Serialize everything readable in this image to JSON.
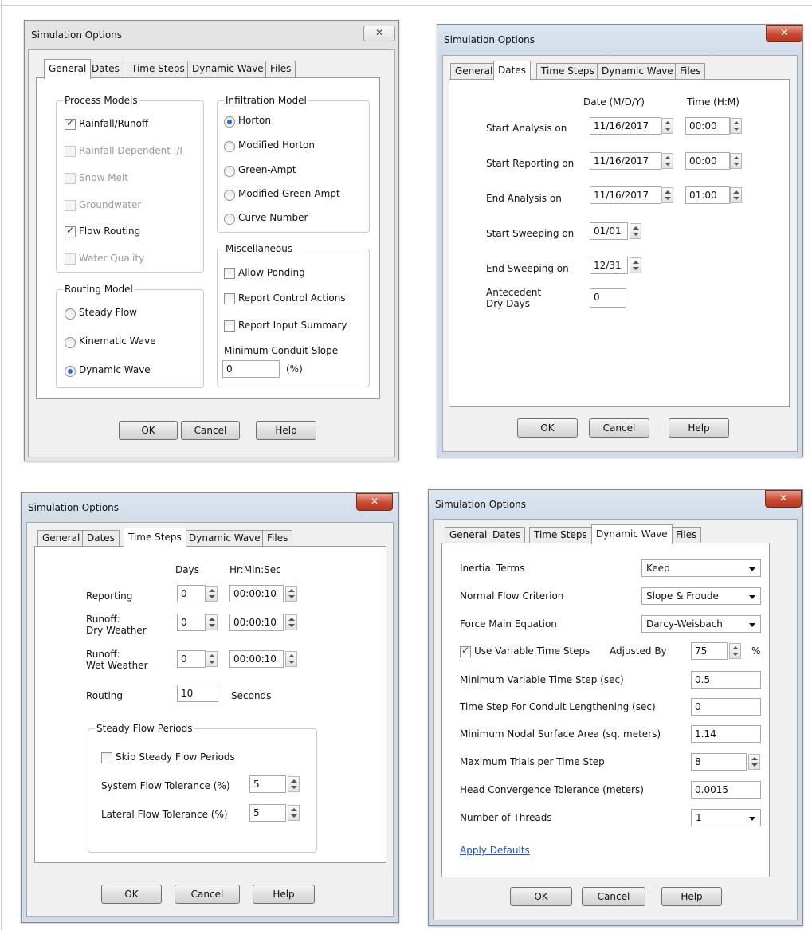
{
  "dialog_title": "Simulation Options",
  "tabs": [
    "General",
    "Dates",
    "Time Steps",
    "Dynamic Wave",
    "Files"
  ],
  "buttons": {
    "ok": "OK",
    "cancel": "Cancel",
    "help": "Help"
  },
  "close_symbol": "✕",
  "general": {
    "process_models": {
      "title": "Process Models",
      "items": [
        {
          "label": "Rainfall/Runoff",
          "checked": true,
          "enabled": true
        },
        {
          "label": "Rainfall Dependent I/I",
          "checked": false,
          "enabled": false
        },
        {
          "label": "Snow Melt",
          "checked": false,
          "enabled": false
        },
        {
          "label": "Groundwater",
          "checked": false,
          "enabled": false
        },
        {
          "label": "Flow Routing",
          "checked": true,
          "enabled": true
        },
        {
          "label": "Water Quality",
          "checked": false,
          "enabled": false
        }
      ]
    },
    "infiltration_model": {
      "title": "Infiltration Model",
      "options": [
        "Horton",
        "Modified Horton",
        "Green-Ampt",
        "Modified Green-Ampt",
        "Curve Number"
      ],
      "selected": "Horton"
    },
    "routing_model": {
      "title": "Routing Model",
      "options": [
        "Steady Flow",
        "Kinematic Wave",
        "Dynamic Wave"
      ],
      "selected": "Dynamic Wave"
    },
    "miscellaneous": {
      "title": "Miscellaneous",
      "items": [
        "Allow Ponding",
        "Report Control Actions",
        "Report Input Summary"
      ],
      "min_slope_label": "Minimum Conduit Slope",
      "min_slope_value": "0",
      "min_slope_unit": "(%)"
    }
  },
  "dates": {
    "date_header": "Date (M/D/Y)",
    "time_header": "Time (H:M)",
    "start_analysis": {
      "label": "Start Analysis on",
      "date": "11/16/2017",
      "time": "00:00"
    },
    "start_reporting": {
      "label": "Start Reporting on",
      "date": "11/16/2017",
      "time": "00:00"
    },
    "end_analysis": {
      "label": "End Analysis on",
      "date": "11/16/2017",
      "time": "01:00"
    },
    "start_sweeping": {
      "label": "Start Sweeping on",
      "value": "01/01"
    },
    "end_sweeping": {
      "label": "End Sweeping on",
      "value": "12/31"
    },
    "antecedent": {
      "label_line1": "Antecedent",
      "label_line2": "Dry Days",
      "value": "0"
    }
  },
  "time_steps": {
    "days_header": "Days",
    "hms_header": "Hr:Min:Sec",
    "reporting": {
      "label": "Reporting",
      "days": "0",
      "hms": "00:00:10"
    },
    "runoff_dry": {
      "label_line1": "Runoff:",
      "label_line2": "Dry Weather",
      "days": "0",
      "hms": "00:00:10"
    },
    "runoff_wet": {
      "label_line1": "Runoff:",
      "label_line2": "Wet Weather",
      "days": "0",
      "hms": "00:00:10"
    },
    "routing": {
      "label": "Routing",
      "value": "10",
      "unit": "Seconds"
    },
    "steady": {
      "title": "Steady Flow Periods",
      "skip_label": "Skip Steady Flow Periods",
      "system_label": "System Flow Tolerance (%)",
      "system_value": "5",
      "lateral_label": "Lateral Flow Tolerance (%)",
      "lateral_value": "5"
    }
  },
  "dynamic_wave": {
    "inertial_terms": {
      "label": "Inertial Terms",
      "value": "Keep"
    },
    "normal_flow": {
      "label": "Normal Flow Criterion",
      "value": "Slope & Froude"
    },
    "force_main": {
      "label": "Force Main Equation",
      "value": "Darcy-Weisbach"
    },
    "variable_steps": {
      "label": "Use Variable Time Steps",
      "checked": true,
      "adjusted_label": "Adjusted By",
      "adjusted_value": "75",
      "unit": "%"
    },
    "min_step": {
      "label": "Minimum Variable Time Step (sec)",
      "value": "0.5"
    },
    "lengthening": {
      "label": "Time Step For Conduit Lengthening (sec)",
      "value": "0"
    },
    "nodal_area": {
      "label": "Minimum Nodal Surface Area (sq. meters)",
      "value": "1.14"
    },
    "max_trials": {
      "label": "Maximum Trials per Time Step",
      "value": "8"
    },
    "head_tol": {
      "label": "Head Convergence Tolerance (meters)",
      "value": "0.0015"
    },
    "threads": {
      "label": "Number of Threads",
      "value": "1"
    },
    "apply_defaults": "Apply Defaults"
  }
}
